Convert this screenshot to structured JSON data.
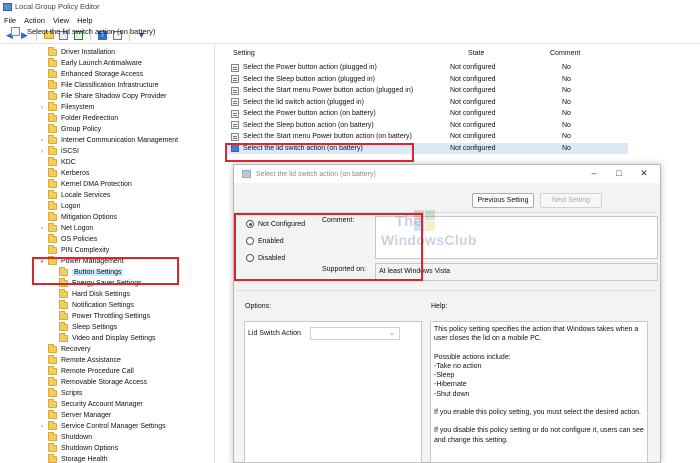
{
  "window": {
    "title": "Local Group Policy Editor"
  },
  "menu": [
    "File",
    "Action",
    "View",
    "Help"
  ],
  "toolbar": {
    "icons": [
      "back-arrow-icon",
      "forward-arrow-icon",
      "up-folder-icon",
      "show-hide-tree-icon",
      "export-list-icon",
      "help-icon",
      "properties-icon",
      "filter-icon"
    ]
  },
  "tree": {
    "items": [
      {
        "label": "Driver Installation",
        "indent": 0,
        "expandable": false
      },
      {
        "label": "Early Launch Antimalware",
        "indent": 0,
        "expandable": false
      },
      {
        "label": "Enhanced Storage Access",
        "indent": 0,
        "expandable": false
      },
      {
        "label": "File Classification Infrastructure",
        "indent": 0,
        "expandable": false
      },
      {
        "label": "File Share Shadow Copy Provider",
        "indent": 0,
        "expandable": false
      },
      {
        "label": "Filesystem",
        "indent": 0,
        "expandable": true
      },
      {
        "label": "Folder Redirection",
        "indent": 0,
        "expandable": false
      },
      {
        "label": "Group Policy",
        "indent": 0,
        "expandable": false
      },
      {
        "label": "Internet Communication Management",
        "indent": 0,
        "expandable": true
      },
      {
        "label": "iSCSI",
        "indent": 0,
        "expandable": true
      },
      {
        "label": "KDC",
        "indent": 0,
        "expandable": false
      },
      {
        "label": "Kerberos",
        "indent": 0,
        "expandable": false
      },
      {
        "label": "Kernel DMA Protection",
        "indent": 0,
        "expandable": false
      },
      {
        "label": "Locale Services",
        "indent": 0,
        "expandable": false
      },
      {
        "label": "Logon",
        "indent": 0,
        "expandable": false
      },
      {
        "label": "Mitigation Options",
        "indent": 0,
        "expandable": false
      },
      {
        "label": "Net Logon",
        "indent": 0,
        "expandable": true
      },
      {
        "label": "OS Policies",
        "indent": 0,
        "expandable": false
      },
      {
        "label": "PIN Complexity",
        "indent": 0,
        "expandable": false
      },
      {
        "label": "Power Management",
        "indent": 0,
        "expandable": true,
        "expanded": true
      },
      {
        "label": "Button Settings",
        "indent": 1,
        "expandable": false,
        "selected": true
      },
      {
        "label": "Energy Saver Settings",
        "indent": 1,
        "expandable": false
      },
      {
        "label": "Hard Disk Settings",
        "indent": 1,
        "expandable": false
      },
      {
        "label": "Notification Settings",
        "indent": 1,
        "expandable": false
      },
      {
        "label": "Power Throttling Settings",
        "indent": 1,
        "expandable": false
      },
      {
        "label": "Sleep Settings",
        "indent": 1,
        "expandable": false
      },
      {
        "label": "Video and Display Settings",
        "indent": 1,
        "expandable": false
      },
      {
        "label": "Recovery",
        "indent": 0,
        "expandable": false
      },
      {
        "label": "Remote Assistance",
        "indent": 0,
        "expandable": false
      },
      {
        "label": "Remote Procedure Call",
        "indent": 0,
        "expandable": false
      },
      {
        "label": "Removable Storage Access",
        "indent": 0,
        "expandable": false
      },
      {
        "label": "Scripts",
        "indent": 0,
        "expandable": false
      },
      {
        "label": "Security Account Manager",
        "indent": 0,
        "expandable": false
      },
      {
        "label": "Server Manager",
        "indent": 0,
        "expandable": false
      },
      {
        "label": "Service Control Manager Settings",
        "indent": 0,
        "expandable": true
      },
      {
        "label": "Shutdown",
        "indent": 0,
        "expandable": false
      },
      {
        "label": "Shutdown Options",
        "indent": 0,
        "expandable": false
      },
      {
        "label": "Storage Health",
        "indent": 0,
        "expandable": false
      }
    ]
  },
  "list": {
    "columns": {
      "setting": "Setting",
      "state": "State",
      "comment": "Comment"
    },
    "rows": [
      {
        "setting": "Select the Power button action (plugged in)",
        "state": "Not configured",
        "comment": "No"
      },
      {
        "setting": "Select the Sleep button action (plugged in)",
        "state": "Not configured",
        "comment": "No"
      },
      {
        "setting": "Select the Start menu Power button action (plugged in)",
        "state": "Not configured",
        "comment": "No"
      },
      {
        "setting": "Select the lid switch action (plugged in)",
        "state": "Not configured",
        "comment": "No"
      },
      {
        "setting": "Select the Power button action (on battery)",
        "state": "Not configured",
        "comment": "No"
      },
      {
        "setting": "Select the Sleep button action (on battery)",
        "state": "Not configured",
        "comment": "No"
      },
      {
        "setting": "Select the Start menu Power button action (on battery)",
        "state": "Not configured",
        "comment": "No"
      },
      {
        "setting": "Select the lid switch action (on battery)",
        "state": "Not configured",
        "comment": "No",
        "highlighted": true
      }
    ]
  },
  "dialog": {
    "title": "Select the lid switch action (on battery)",
    "header_label": "Select the lid switch action (on battery)",
    "previous_button": "Previous Setting",
    "next_button": "Next Setting",
    "options": [
      {
        "label": "Not Configured",
        "checked": true
      },
      {
        "label": "Enabled",
        "checked": false
      },
      {
        "label": "Disabled",
        "checked": false
      }
    ],
    "comment_label": "Comment:",
    "supported_label": "Supported on:",
    "supported_value": "At least Windows Vista",
    "options_label": "Options:",
    "help_label": "Help:",
    "lid_switch_label": "Lid Switch Action",
    "help_paragraphs": [
      "This policy setting specifies the action that Windows takes when a user closes the lid on a mobile PC.",
      "Possible actions include:",
      "-Take no action",
      "-Sleep",
      "-Hibernate",
      "-Shut down",
      "If you enable this policy setting, you must select the desired action.",
      "If you disable this policy setting or do not configure it, users can see and change this setting."
    ]
  },
  "watermark": {
    "line1": "The",
    "line2": "WindowsClub"
  },
  "colors": {
    "highlight_red": "#d9252f",
    "selection_blue": "#cce8ff",
    "folder_yellow": "#f5cd5c"
  }
}
